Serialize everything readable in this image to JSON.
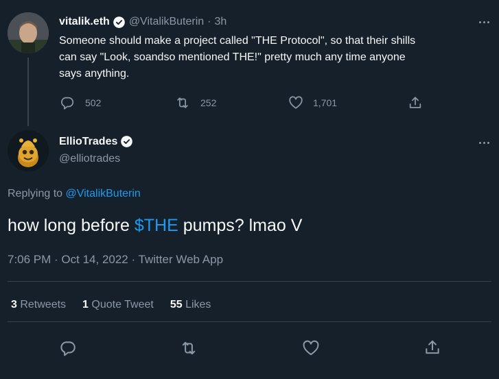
{
  "parent_tweet": {
    "display_name": "vitalik.eth",
    "handle": "@VitalikButerin",
    "separator": "·",
    "time": "3h",
    "text_line1": "Someone should make a project called \"THE Protocol\", so that their shills",
    "text_line2": "can say \"Look, soandso mentioned THE!\" pretty much any time anyone",
    "text_line3": "says anything.",
    "replies": "502",
    "retweets": "252",
    "likes": "1,701"
  },
  "main_tweet": {
    "display_name": "EllioTrades",
    "handle": "@elliotrades",
    "replying_prefix": "Replying to ",
    "replying_to": "@VitalikButerin",
    "text_before": "how long before ",
    "cashtag": "$THE",
    "text_after": " pumps? lmao V",
    "timestamp": "7:06 PM · Oct 14, 2022 · Twitter Web App",
    "stats": {
      "retweets_count": "3",
      "retweets_label": " Retweets",
      "quotes_count": "1",
      "quotes_label": " Quote Tweet",
      "likes_count": "55",
      "likes_label": " Likes"
    }
  },
  "colors": {
    "background": "#15202b",
    "text": "#f7f9f9",
    "muted": "#8b98a5",
    "accent": "#1d9bf0",
    "divider": "#38444d"
  },
  "icons": [
    "verified-badge-icon",
    "more-icon",
    "reply-icon",
    "retweet-icon",
    "like-icon",
    "share-icon"
  ]
}
